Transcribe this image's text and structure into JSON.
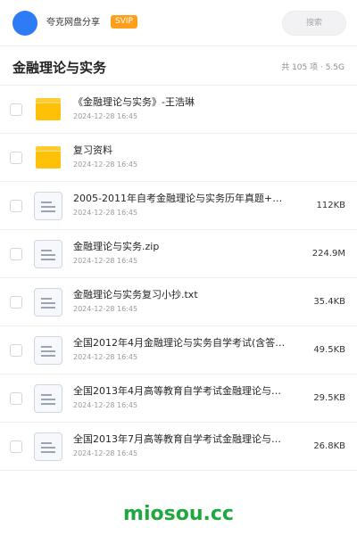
{
  "header": {
    "brand": "夸克网盘分享",
    "badge": "SVIP",
    "search_placeholder": "搜索",
    "avatar_color": "#2d7cf6",
    "badge_color": "#ff9f1c"
  },
  "folder": {
    "title": "金融理论与实务",
    "summary": "共 105 项 · 5.5G"
  },
  "files": [
    {
      "type": "folder-icon",
      "name": "《金融理论与实务》-王浩琳",
      "date": "2024-12-28 16:45",
      "size": ""
    },
    {
      "type": "folder-icon",
      "name": "复习资料",
      "date": "2024-12-28 16:45",
      "size": ""
    },
    {
      "type": "document-icon",
      "name": "2005-2011年自考金融理论与实务历年真题+答…",
      "date": "2024-12-28 16:45",
      "size": "112KB"
    },
    {
      "type": "document-icon",
      "name": "金融理论与实务.zip",
      "date": "2024-12-28 16:45",
      "size": "224.9M"
    },
    {
      "type": "document-icon",
      "name": "金融理论与实务复习小抄.txt",
      "date": "2024-12-28 16:45",
      "size": "35.4KB"
    },
    {
      "type": "document-icon",
      "name": "全国2012年4月金融理论与实务自学考试(含答案)…",
      "date": "2024-12-28 16:45",
      "size": "49.5KB"
    },
    {
      "type": "document-icon",
      "name": "全国2013年4月高等教育自学考试金融理论与实务试…",
      "date": "2024-12-28 16:45",
      "size": "29.5KB"
    },
    {
      "type": "document-icon",
      "name": "全国2013年7月高等教育自学考试金融理论与实务试…",
      "date": "2024-12-28 16:45",
      "size": "26.8KB"
    }
  ],
  "watermark": {
    "text": "miosou.cc",
    "color": "#1fa83f"
  }
}
